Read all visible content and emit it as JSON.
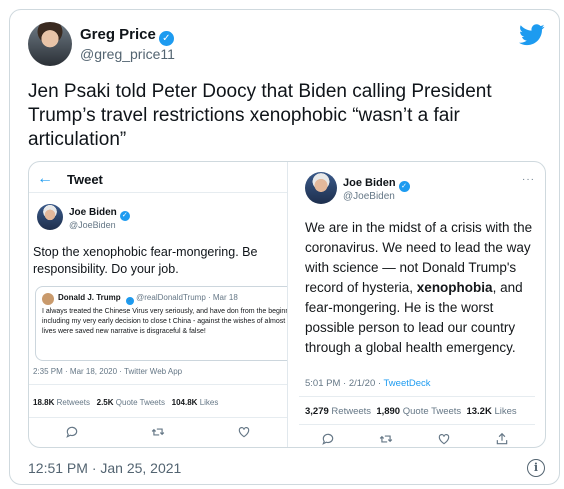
{
  "author": {
    "name": "Greg Price",
    "handle": "@greg_price11"
  },
  "tweet": {
    "text": "Jen Psaki told Peter Doocy that Biden calling President Trump’s travel restrictions xenophobic “wasn’t a fair articulation”",
    "timestamp": "12:51 PM · Jan 25, 2021"
  },
  "left_screenshot": {
    "back_icon": "←",
    "header": "Tweet",
    "name": "Joe Biden",
    "handle": "@JoeBiden",
    "text_line1": "Stop the xenophobic fear-mongering. Be",
    "text_line2": "responsibility. Do your job.",
    "quote": {
      "name": "Donald J. Trump",
      "handle_time": "@realDonaldTrump · Mar 18",
      "text": "I always treated the Chinese Virus very seriously, and have don from the beginning, including my very early decision to close t China - against the wishes of almost all. Many lives were saved new narrative is disgraceful & false!"
    },
    "meta": "2:35 PM · Mar 18, 2020 · Twitter Web App",
    "retweets_count": "18.8K",
    "retweets_label": "Retweets",
    "quotes_count": "2.5K",
    "quotes_label": "Quote Tweets",
    "likes_count": "104.8K",
    "likes_label": "Likes"
  },
  "right_screenshot": {
    "name": "Joe Biden",
    "handle": "@JoeBiden",
    "more_icon": "···",
    "text_before": "We are in the midst of a crisis with the coronavirus. We need to lead the way with science — not Donald Trump's record of hysteria, ",
    "text_bold": "xenophobia",
    "text_after": ", and fear-mongering. He is the worst possible person to lead our country through a global health emergency.",
    "time": "5:01 PM · 2/1/20 · ",
    "source": "TweetDeck",
    "retweets_count": "3,279",
    "retweets_label": "Retweets",
    "quotes_count": "1,890",
    "quotes_label": "Quote Tweets",
    "likes_count": "13.2K",
    "likes_label": "Likes"
  },
  "colors": {
    "twitter_blue": "#1d9bf0",
    "secondary_text": "#536471",
    "border": "#cfd9de"
  },
  "icons": [
    "twitter-bird-icon",
    "verified-badge-icon",
    "back-arrow-icon",
    "reply-icon",
    "retweet-icon",
    "like-icon",
    "share-icon",
    "more-icon",
    "info-icon"
  ]
}
